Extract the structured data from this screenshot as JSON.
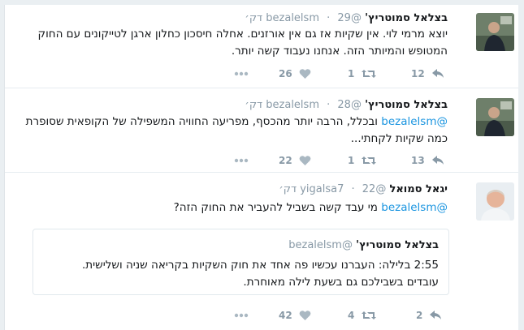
{
  "tweets": [
    {
      "name": "בצלאל סמוטריץ'",
      "handle": "@bezalelsm",
      "time": "29 דק׳",
      "text": "יוצא מרמי לוי. אין שקיות אז גם אין אורזנים. אחלה חיסכון כחלון ארגן לטייקונים עם החוק המטופש והמיותר הזה. אנחנו נעבוד קשה יותר.",
      "mention": "",
      "replies": "12",
      "retweets": "1",
      "likes": "26"
    },
    {
      "name": "בצלאל סמוטריץ'",
      "handle": "@bezalelsm",
      "time": "28 דק׳",
      "text": "ובכלל, הרבה יותר מהכסף, מפריעה החוויה המשפילה של הקופאית שסופרת כמה שקיות לקחתי...",
      "mention": "@bezalelsm",
      "replies": "13",
      "retweets": "1",
      "likes": "22"
    },
    {
      "name": "יגאל סמואל",
      "handle": "@yigalsa7",
      "time": "22 דק׳",
      "text": "מי עבד קשה בשביל להעביר את החוק הזה?",
      "mention": "@bezalelsm",
      "replies": "2",
      "retweets": "4",
      "likes": "42",
      "quote": {
        "name": "בצלאל סמוטריץ'",
        "handle": "@bezalelsm",
        "text": "2:55 בלילה: העברנו עכשיו פה אחד את חוק השקיות בקריאה שניה ושלישית. עובדים בשבילכם גם בשעת לילה מאוחרת."
      }
    }
  ],
  "colors": {
    "link": "#1b95e0",
    "meta": "#8899a6",
    "text": "#14171a"
  },
  "icons": [
    "reply-icon",
    "retweet-icon",
    "heart-icon",
    "more-icon"
  ]
}
